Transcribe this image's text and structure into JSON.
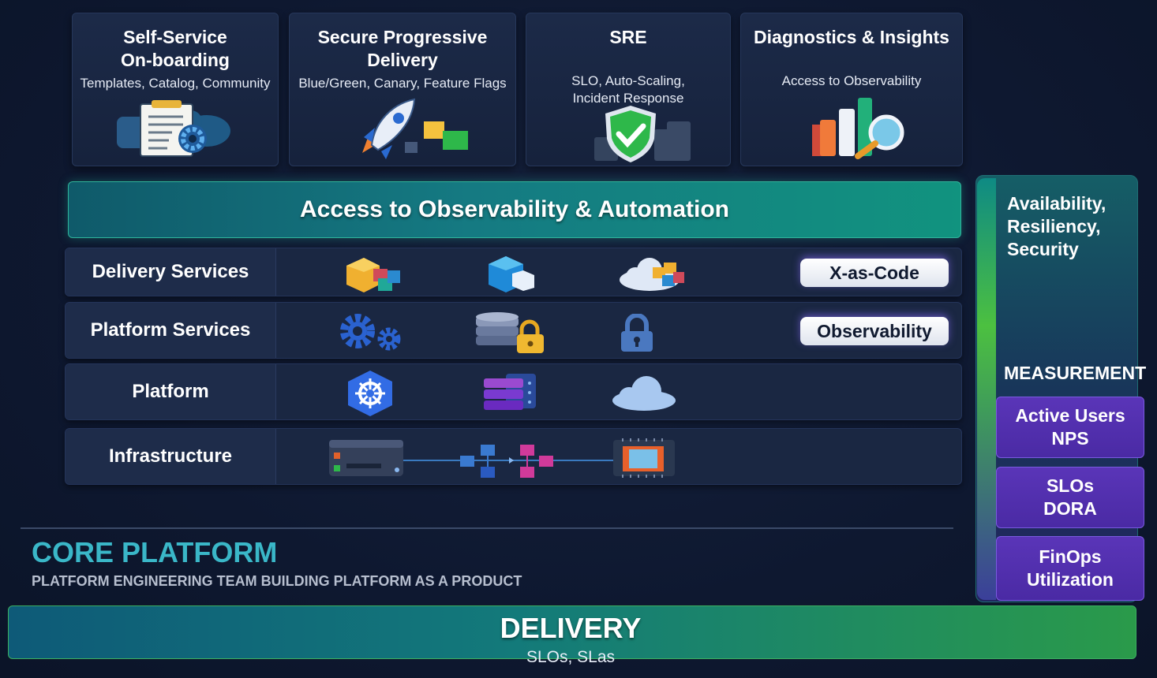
{
  "top_cards": [
    {
      "title": "Self-Service\nOn-boarding",
      "subtitle": "Templates, Catalog, Community",
      "icon": "clipboard-gear-icon"
    },
    {
      "title": "Secure Progressive\nDelivery",
      "subtitle": "Blue/Green, Canary, Feature Flags",
      "icon": "rocket-icon"
    },
    {
      "title": "SRE",
      "subtitle": "SLO, Auto-Scaling,\nIncident Response",
      "icon": "shield-check-icon"
    },
    {
      "title": "Diagnostics & Insights",
      "subtitle": "Access to Observability",
      "icon": "chart-magnifier-icon"
    }
  ],
  "banner": {
    "text": "Access to Observability & Automation"
  },
  "layers": [
    {
      "label": "Delivery Services",
      "pill": "X-as-Code"
    },
    {
      "label": "Platform Services",
      "pill": "Observability"
    },
    {
      "label": "Platform",
      "pill": ""
    },
    {
      "label": "Infrastructure",
      "pill": ""
    }
  ],
  "core": {
    "title": "CORE PLATFORM",
    "subtitle": "PLATFORM ENGINEERING TEAM BUILDING PLATFORM AS A PRODUCT"
  },
  "measurement": {
    "header": "Availability,\nResiliency,\nSecurity",
    "label": "MEASUREMENT",
    "metrics": [
      "Active Users\nNPS",
      "SLOs\nDORA",
      "FinOps\nUtilization"
    ]
  },
  "delivery": {
    "title": "DELIVERY",
    "subtitle": "SLOs, SLas"
  },
  "colors": {
    "accent_teal": "#3ab7c8",
    "metric_purple": "#5a35b8",
    "banner_teal": "#157a82"
  }
}
